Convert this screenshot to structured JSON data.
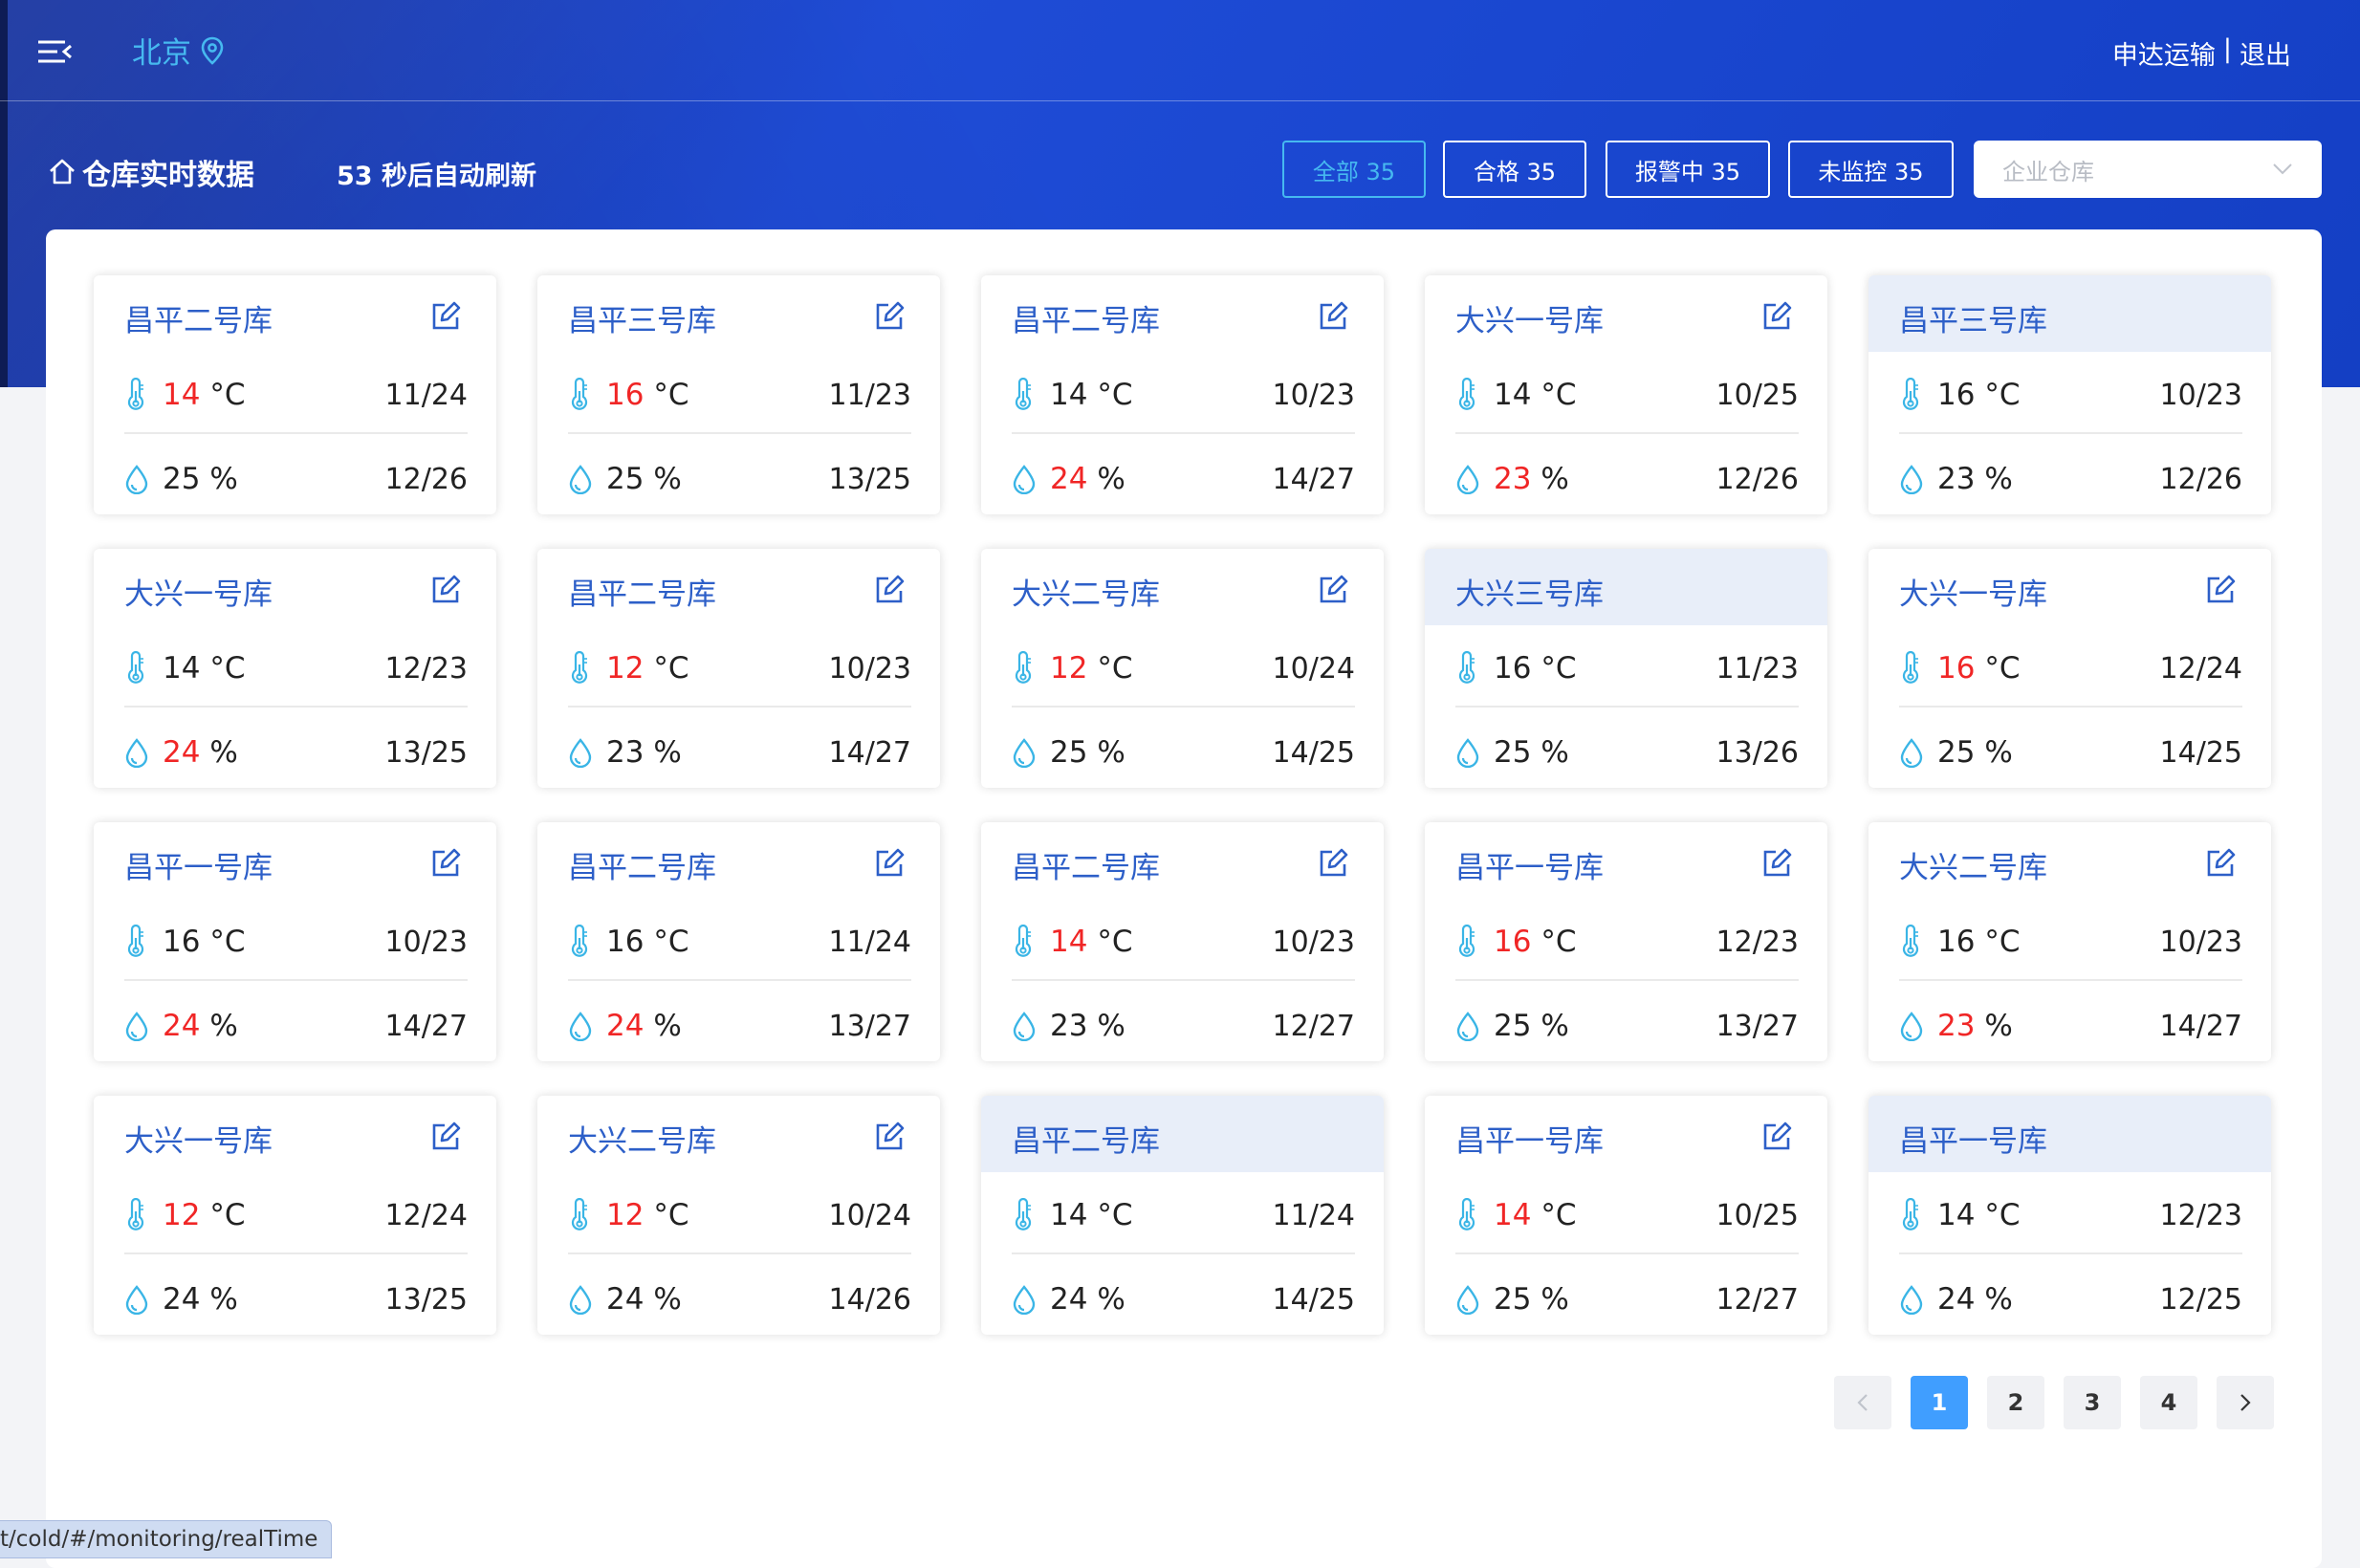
{
  "header": {
    "city": "北京",
    "user_name": "申达运输",
    "separator": "|",
    "logout_label": "退出"
  },
  "page": {
    "title": "仓库实时数据",
    "refresh_text": "53 秒后自动刷新"
  },
  "filters": {
    "all_label": "全部 35",
    "pass_label": "合格 35",
    "alarm_label": "报警中 35",
    "unmonitored_label": "未监控 35",
    "warehouse_select_placeholder": "企业仓库"
  },
  "colors": {
    "accent_blue": "#2d5fc8",
    "alarm_red": "#f02626",
    "highlight_bg": "#e8eef9",
    "icon_cyan": "#3ab5e6"
  },
  "cards": [
    {
      "name": "昌平二号库",
      "temp": "14",
      "temp_unit": "°C",
      "temp_alarm": true,
      "temp_range": "11/24",
      "hum": "25",
      "hum_unit": "%",
      "hum_alarm": false,
      "hum_range": "12/26",
      "highlighted": false
    },
    {
      "name": "昌平三号库",
      "temp": "16",
      "temp_unit": "°C",
      "temp_alarm": true,
      "temp_range": "11/23",
      "hum": "25",
      "hum_unit": "%",
      "hum_alarm": false,
      "hum_range": "13/25",
      "highlighted": false
    },
    {
      "name": "昌平二号库",
      "temp": "14",
      "temp_unit": "°C",
      "temp_alarm": false,
      "temp_range": "10/23",
      "hum": "24",
      "hum_unit": "%",
      "hum_alarm": true,
      "hum_range": "14/27",
      "highlighted": false
    },
    {
      "name": "大兴一号库",
      "temp": "14",
      "temp_unit": "°C",
      "temp_alarm": false,
      "temp_range": "10/25",
      "hum": "23",
      "hum_unit": "%",
      "hum_alarm": true,
      "hum_range": "12/26",
      "highlighted": false
    },
    {
      "name": "昌平三号库",
      "temp": "16",
      "temp_unit": "°C",
      "temp_alarm": false,
      "temp_range": "10/23",
      "hum": "23",
      "hum_unit": "%",
      "hum_alarm": false,
      "hum_range": "12/26",
      "highlighted": true
    },
    {
      "name": "大兴一号库",
      "temp": "14",
      "temp_unit": "°C",
      "temp_alarm": false,
      "temp_range": "12/23",
      "hum": "24",
      "hum_unit": "%",
      "hum_alarm": true,
      "hum_range": "13/25",
      "highlighted": false
    },
    {
      "name": "昌平二号库",
      "temp": "12",
      "temp_unit": "°C",
      "temp_alarm": true,
      "temp_range": "10/23",
      "hum": "23",
      "hum_unit": "%",
      "hum_alarm": false,
      "hum_range": "14/27",
      "highlighted": false
    },
    {
      "name": "大兴二号库",
      "temp": "12",
      "temp_unit": "°C",
      "temp_alarm": true,
      "temp_range": "10/24",
      "hum": "25",
      "hum_unit": "%",
      "hum_alarm": false,
      "hum_range": "14/25",
      "highlighted": false
    },
    {
      "name": "大兴三号库",
      "temp": "16",
      "temp_unit": "°C",
      "temp_alarm": false,
      "temp_range": "11/23",
      "hum": "25",
      "hum_unit": "%",
      "hum_alarm": false,
      "hum_range": "13/26",
      "highlighted": true
    },
    {
      "name": "大兴一号库",
      "temp": "16",
      "temp_unit": "°C",
      "temp_alarm": true,
      "temp_range": "12/24",
      "hum": "25",
      "hum_unit": "%",
      "hum_alarm": false,
      "hum_range": "14/25",
      "highlighted": false
    },
    {
      "name": "昌平一号库",
      "temp": "16",
      "temp_unit": "°C",
      "temp_alarm": false,
      "temp_range": "10/23",
      "hum": "24",
      "hum_unit": "%",
      "hum_alarm": true,
      "hum_range": "14/27",
      "highlighted": false
    },
    {
      "name": "昌平二号库",
      "temp": "16",
      "temp_unit": "°C",
      "temp_alarm": false,
      "temp_range": "11/24",
      "hum": "24",
      "hum_unit": "%",
      "hum_alarm": true,
      "hum_range": "13/27",
      "highlighted": false
    },
    {
      "name": "昌平二号库",
      "temp": "14",
      "temp_unit": "°C",
      "temp_alarm": true,
      "temp_range": "10/23",
      "hum": "23",
      "hum_unit": "%",
      "hum_alarm": false,
      "hum_range": "12/27",
      "highlighted": false
    },
    {
      "name": "昌平一号库",
      "temp": "16",
      "temp_unit": "°C",
      "temp_alarm": true,
      "temp_range": "12/23",
      "hum": "25",
      "hum_unit": "%",
      "hum_alarm": false,
      "hum_range": "13/27",
      "highlighted": false
    },
    {
      "name": "大兴二号库",
      "temp": "16",
      "temp_unit": "°C",
      "temp_alarm": false,
      "temp_range": "10/23",
      "hum": "23",
      "hum_unit": "%",
      "hum_alarm": true,
      "hum_range": "14/27",
      "highlighted": false
    },
    {
      "name": "大兴一号库",
      "temp": "12",
      "temp_unit": "°C",
      "temp_alarm": true,
      "temp_range": "12/24",
      "hum": "24",
      "hum_unit": "%",
      "hum_alarm": false,
      "hum_range": "13/25",
      "highlighted": false
    },
    {
      "name": "大兴二号库",
      "temp": "12",
      "temp_unit": "°C",
      "temp_alarm": true,
      "temp_range": "10/24",
      "hum": "24",
      "hum_unit": "%",
      "hum_alarm": false,
      "hum_range": "14/26",
      "highlighted": false
    },
    {
      "name": "昌平二号库",
      "temp": "14",
      "temp_unit": "°C",
      "temp_alarm": false,
      "temp_range": "11/24",
      "hum": "24",
      "hum_unit": "%",
      "hum_alarm": false,
      "hum_range": "14/25",
      "highlighted": true
    },
    {
      "name": "昌平一号库",
      "temp": "14",
      "temp_unit": "°C",
      "temp_alarm": true,
      "temp_range": "10/25",
      "hum": "25",
      "hum_unit": "%",
      "hum_alarm": false,
      "hum_range": "12/27",
      "highlighted": false
    },
    {
      "name": "昌平一号库",
      "temp": "14",
      "temp_unit": "°C",
      "temp_alarm": false,
      "temp_range": "12/23",
      "hum": "24",
      "hum_unit": "%",
      "hum_alarm": false,
      "hum_range": "12/25",
      "highlighted": true
    }
  ],
  "pagination": {
    "prev_icon": "chevron-left-icon",
    "pages": [
      "1",
      "2",
      "3",
      "4"
    ],
    "current": "1",
    "next_icon": "chevron-right-icon"
  },
  "status_bar": {
    "url": "t/cold/#/monitoring/realTime"
  }
}
